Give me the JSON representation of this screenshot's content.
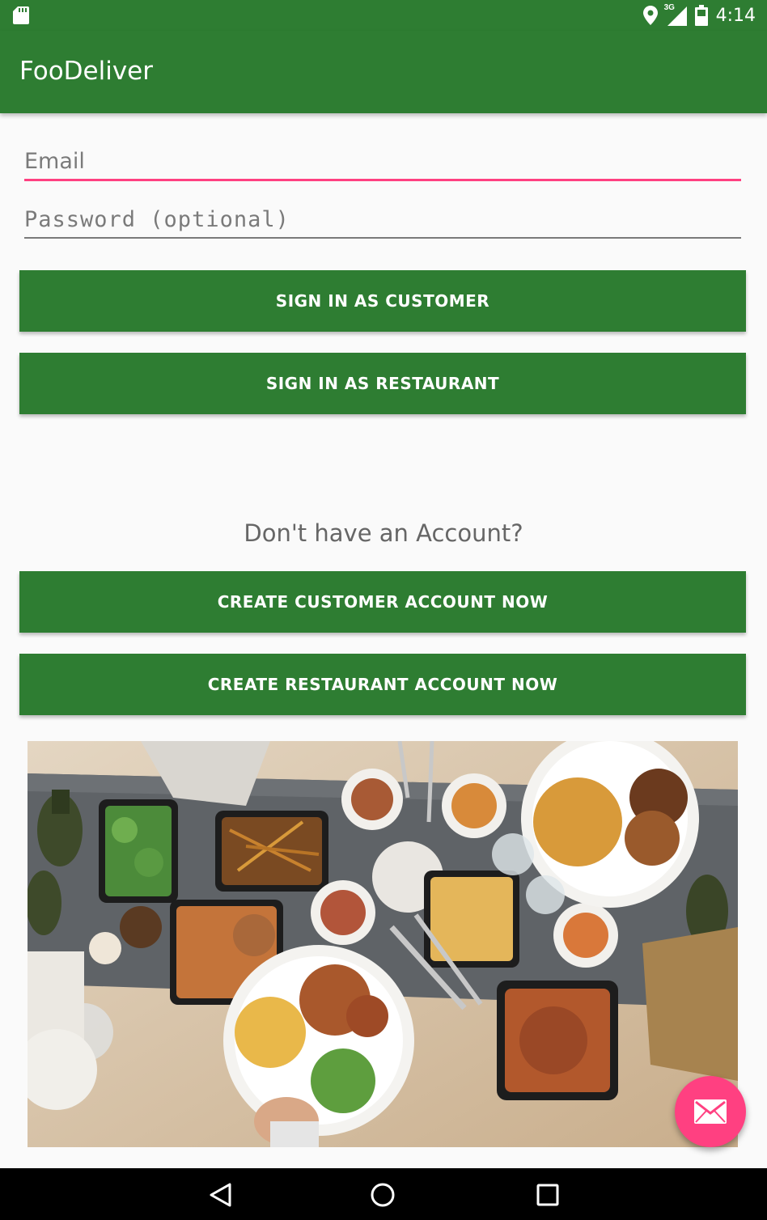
{
  "status_bar": {
    "time": "4:14",
    "network_label": "3G",
    "icons": [
      "sd-card-icon",
      "location-icon",
      "signal-icon",
      "battery-icon"
    ]
  },
  "app_bar": {
    "title": "FooDeliver"
  },
  "login_form": {
    "email_placeholder": "Email",
    "email_value": "",
    "password_placeholder": "Password (optional)",
    "password_value": "",
    "sign_in_customer_label": "SIGN IN AS CUSTOMER",
    "sign_in_restaurant_label": "SIGN IN AS RESTAURANT"
  },
  "signup": {
    "prompt": "Don't have an Account?",
    "create_customer_label": "CREATE CUSTOMER ACCOUNT NOW",
    "create_restaurant_label": "CREATE RESTAURANT ACCOUNT NOW"
  },
  "fab": {
    "icon": "mail-icon"
  },
  "colors": {
    "primary": "#2e7d32",
    "accent": "#ff4081",
    "background": "#fafafa"
  },
  "nav_bar": {
    "icons": [
      "back-icon",
      "home-icon",
      "recents-icon"
    ]
  }
}
